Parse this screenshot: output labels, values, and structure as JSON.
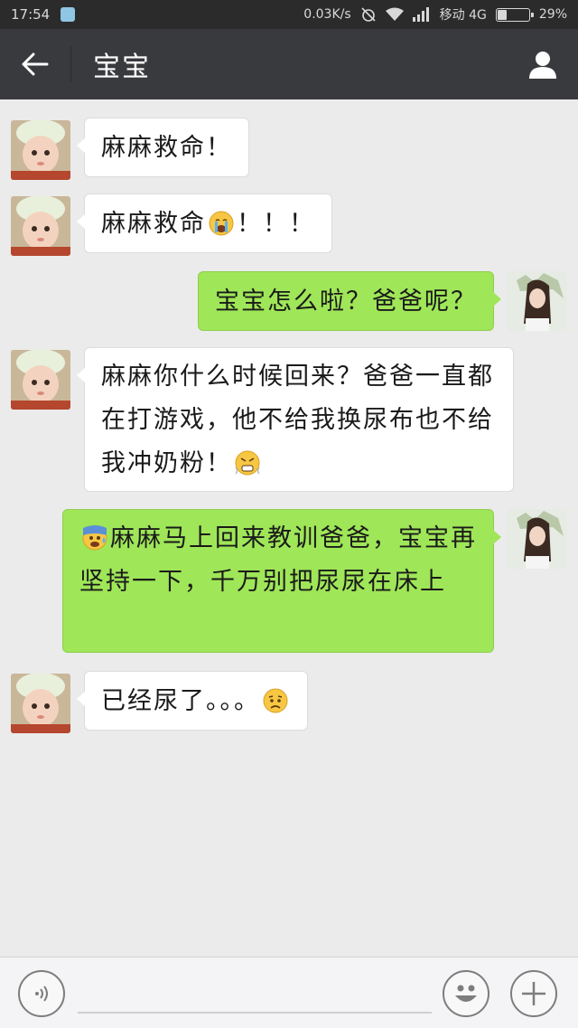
{
  "status_bar": {
    "time": "17:54",
    "speed": "0.03K/s",
    "carrier": "移动 4G",
    "battery": "29%",
    "battery_level": 0.29
  },
  "header": {
    "title": "宝宝",
    "back_icon": "arrow-left-icon",
    "profile_icon": "person-icon"
  },
  "messages": [
    {
      "side": "in",
      "text": "麻麻救命！",
      "emoji_after": ""
    },
    {
      "side": "in",
      "text": "麻麻救命",
      "emoji_after": "crying-emoji",
      "text_after": "！！！"
    },
    {
      "side": "out",
      "text": "宝宝怎么啦？爸爸呢？"
    },
    {
      "side": "in",
      "text": "麻麻你什么时候回来？爸爸一直都在打游戏，他不给我换尿布也不给我冲奶粉！",
      "emoji_after": "angry-emoji"
    },
    {
      "side": "out",
      "emoji_before": "anxious-emoji",
      "text": "麻麻马上回来教训爸爸，宝宝再坚持一下，千万别把尿尿在床上"
    },
    {
      "side": "in",
      "text": "已经尿了。。。",
      "emoji_after": "worried-emoji"
    }
  ],
  "input_bar": {
    "voice_icon": "voice-icon",
    "emoji_icon": "smiley-icon",
    "more_icon": "plus-icon",
    "placeholder": ""
  },
  "colors": {
    "header_bg": "#393a3e",
    "status_bg": "#2b2b2b",
    "chat_bg": "#ebebeb",
    "out_bubble": "#9fe658",
    "in_bubble": "#ffffff"
  }
}
